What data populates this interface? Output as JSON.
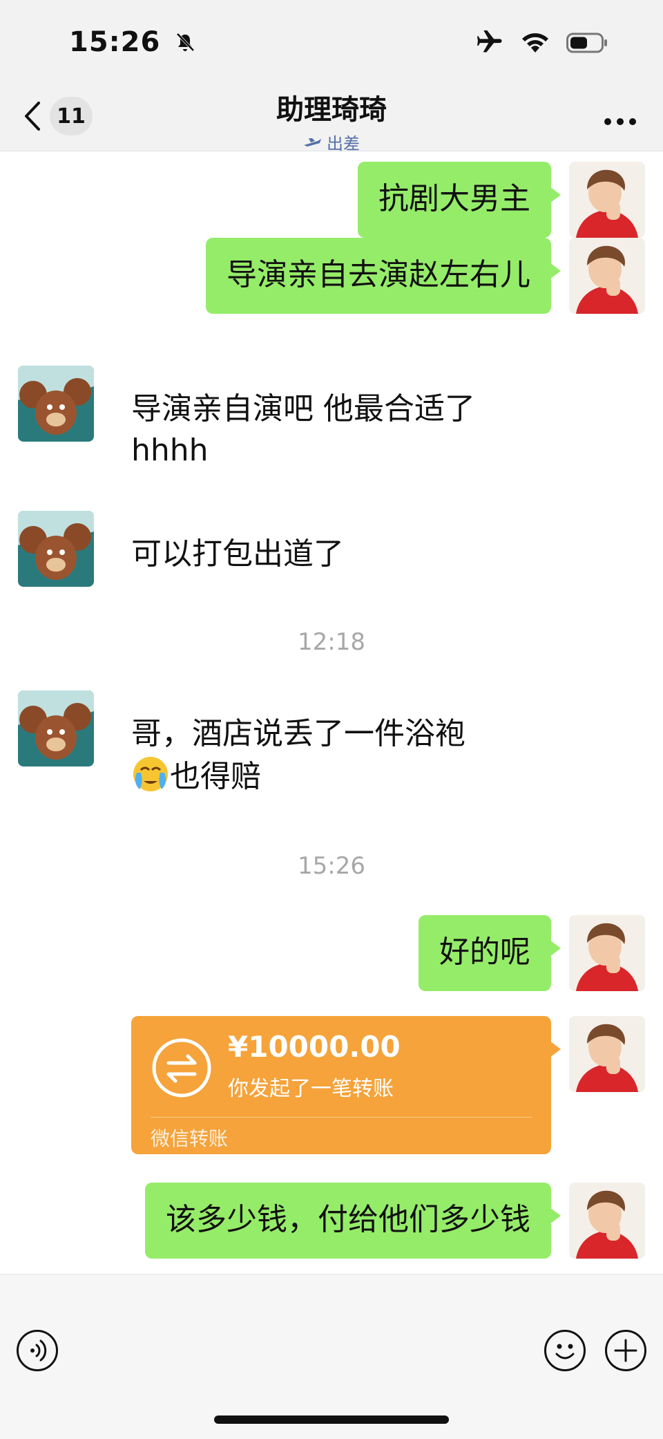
{
  "status_bar": {
    "time": "15:26"
  },
  "nav": {
    "back_count": "11",
    "title": "助理琦琦",
    "subtitle": "出差"
  },
  "messages": [
    {
      "from": "me",
      "text": "抗剧大男主"
    },
    {
      "from": "me",
      "text": "导演亲自去演赵左右儿"
    },
    {
      "from": "them",
      "text": "导演亲自演吧 他最合适了 hhhh"
    },
    {
      "from": "them",
      "text": "可以打包出道了"
    },
    {
      "time": "12:18"
    },
    {
      "from": "them",
      "text": "哥，酒店说丢了一件浴袍",
      "line2": "也得赔"
    },
    {
      "time": "15:26"
    },
    {
      "from": "me",
      "text": "好的呢"
    },
    {
      "from": "me",
      "transfer": {
        "amount": "¥10000.00",
        "desc": "你发起了一笔转账",
        "footer": "微信转账"
      }
    },
    {
      "from": "me",
      "text": "该多少钱，付给他们多少钱"
    }
  ],
  "colors": {
    "my_bubble": "#95ec69",
    "transfer": "#f5a33a",
    "accent": "#5470a8"
  }
}
